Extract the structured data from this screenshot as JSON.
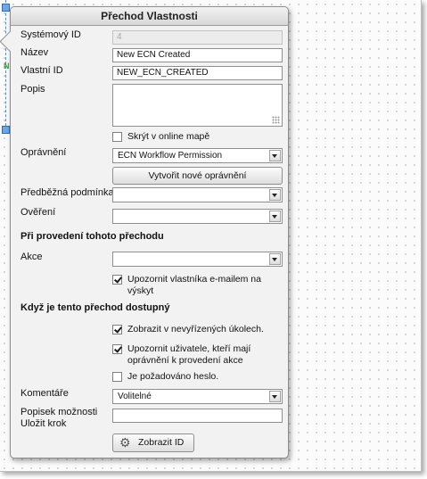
{
  "panel": {
    "title": "Přechod Vlastnosti"
  },
  "fields": {
    "system_id": {
      "label": "Systémový ID",
      "value": "4"
    },
    "name": {
      "label": "Název",
      "value": "New ECN Created"
    },
    "custom_id": {
      "label": "Vlastní ID",
      "value": "NEW_ECN_CREATED"
    },
    "description": {
      "label": "Popis",
      "value": ""
    },
    "hide_online": {
      "label": "Skrýt v online mapě",
      "checked": false
    },
    "permission": {
      "label": "Oprávnění",
      "value": "ECN Workflow Permission"
    },
    "create_permission_button": "Vytvořit nové oprávnění",
    "precondition": {
      "label": "Předběžná podmínka",
      "value": ""
    },
    "verification": {
      "label": "Ověření",
      "value": ""
    }
  },
  "section_on_execute": {
    "heading": "Při provedení tohoto přechodu",
    "action": {
      "label": "Akce",
      "value": ""
    },
    "notify_owner": {
      "label": "Upozornit vlastníka e-mailem na výskyt",
      "checked": true
    }
  },
  "section_when_available": {
    "heading": "Když je tento přechod dostupný",
    "show_in_pending": {
      "label": "Zobrazit v nevyřízených úkolech.",
      "checked": true
    },
    "notify_users": {
      "label": "Upozornit uživatele, kteří mají oprávnění k provedení akce",
      "checked": true
    },
    "password_required": {
      "label": "Je požadováno heslo.",
      "checked": false
    },
    "comments": {
      "label": "Komentáře",
      "value": "Volitelné"
    },
    "save_step_label": {
      "label": "Popisek možnosti Uložit krok",
      "value": ""
    },
    "show_id_button": "Zobrazit ID"
  },
  "icons": {
    "gear": "gear-icon",
    "dropdown": "chevron-down-icon",
    "resize": "resize-grip-icon"
  },
  "colors": {
    "selection": "#4a8fd6",
    "panel_bg": "#f2f2f2",
    "border": "#8e8e8e"
  }
}
